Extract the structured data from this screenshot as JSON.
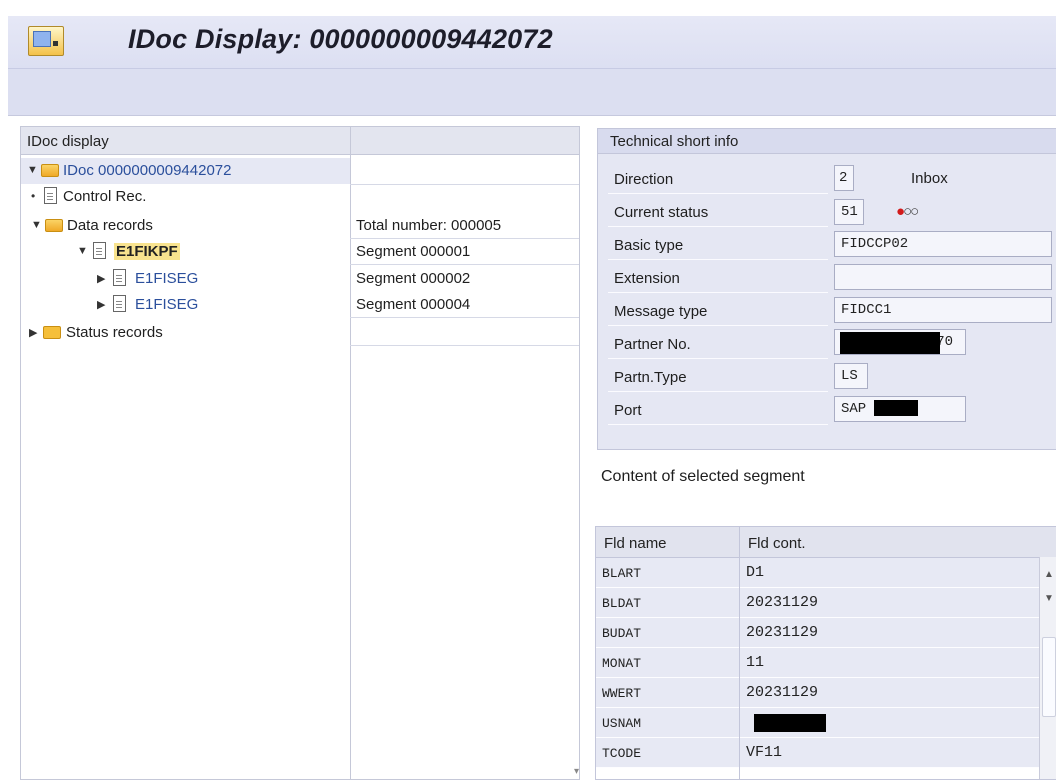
{
  "window": {
    "title": "IDoc Display: 0000000009442072"
  },
  "tree": {
    "header": "IDoc display",
    "nodes": [
      {
        "label": "IDoc 0000000009442072",
        "info": ""
      },
      {
        "label": "Control Rec.",
        "info": ""
      },
      {
        "label": "Data records",
        "info": "Total number: 000005"
      },
      {
        "label": "E1FIKPF",
        "info": "Segment 000001"
      },
      {
        "label": "E1FISEG",
        "info": "Segment 000002"
      },
      {
        "label": "E1FISEG",
        "info": "Segment 000004"
      },
      {
        "label": "Status records",
        "info": ""
      }
    ]
  },
  "technical_info": {
    "header": "Technical short info",
    "fields": [
      {
        "label": "Direction",
        "value": "2",
        "extra": "Inbox"
      },
      {
        "label": "Current status",
        "value": "51"
      },
      {
        "label": "Basic type",
        "value": "FIDCCP02"
      },
      {
        "label": "Extension",
        "value": ""
      },
      {
        "label": "Message type",
        "value": "FIDCC1"
      },
      {
        "label": "Partner No.",
        "value": "70"
      },
      {
        "label": "Partn.Type",
        "value": "LS"
      },
      {
        "label": "Port",
        "value": "SAP"
      }
    ],
    "status_colors": {
      "red": "#d21b1b"
    }
  },
  "segment_content": {
    "title": "Content of selected segment",
    "columns": [
      "Fld name",
      "Fld cont."
    ],
    "rows": [
      {
        "name": "BLART",
        "value": "D1"
      },
      {
        "name": "BLDAT",
        "value": "20231129"
      },
      {
        "name": "BUDAT",
        "value": "20231129"
      },
      {
        "name": "MONAT",
        "value": "11"
      },
      {
        "name": "WWERT",
        "value": "20231129"
      },
      {
        "name": "USNAM",
        "value": ""
      },
      {
        "name": "TCODE",
        "value": "VF11"
      }
    ]
  },
  "icons": [
    "sap-app-icon",
    "folder-icon",
    "document-icon",
    "expand-arrow-icon",
    "collapse-arrow-icon",
    "status-lights-icon",
    "scroll-up-icon",
    "scroll-down-icon"
  ]
}
